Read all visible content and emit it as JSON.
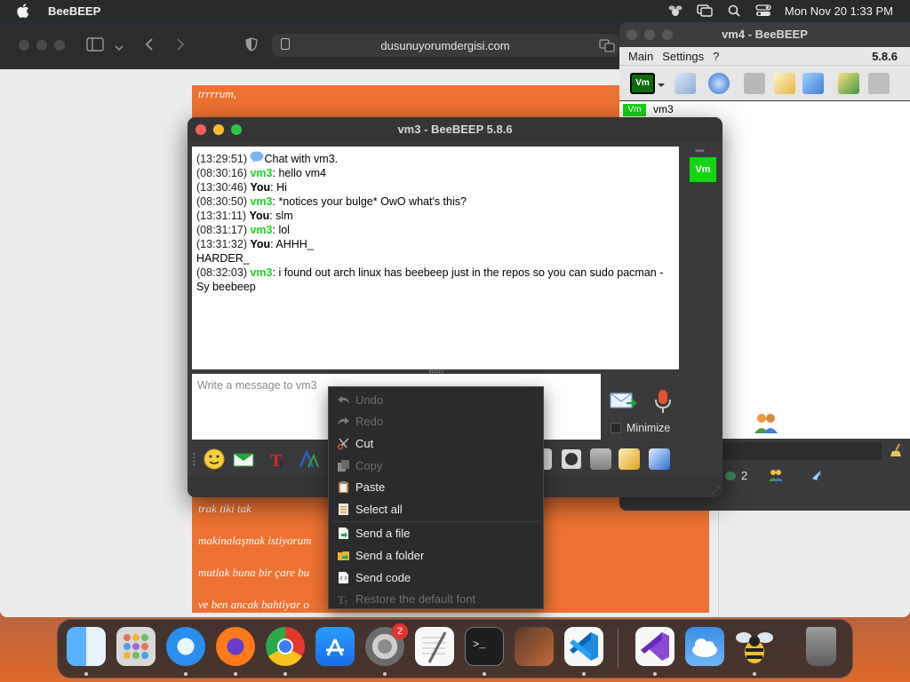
{
  "menubar": {
    "app_name": "BeeBEEP",
    "clock": "Mon Nov 20  1:33 PM"
  },
  "safari": {
    "url": "dusunuyorumdergisi.com",
    "article_lines": [
      "trrrrum,",
      "trak tiki tak",
      "makinalaşmak istiyorum",
      "mutlak buna bir çare bu",
      "ve ben ancak bahtiyar o"
    ],
    "colors": {
      "article_bg": "#ee7332"
    }
  },
  "vm4": {
    "title": "vm4 - BeeBEEP",
    "menu": [
      "Main",
      "Settings",
      "?"
    ],
    "version": "5.8.6",
    "avatar_label": "Vm",
    "user_name": "vm3",
    "status_count": "2"
  },
  "vm3": {
    "title": "vm3 - BeeBEEP 5.8.6",
    "badge": "Vm",
    "composer_placeholder": "Write a message to vm3",
    "minimize_label": "Minimize",
    "messages": [
      {
        "time": "(13:29:51)",
        "speaker": "",
        "text": "Chat with vm3.",
        "kind": "system"
      },
      {
        "time": "(08:30:16)",
        "speaker": "vm3",
        "text": ": hello vm4",
        "kind": "vm"
      },
      {
        "time": "(13:30:46)",
        "speaker": "You",
        "text": ": Hi",
        "kind": "you"
      },
      {
        "time": "(08:30:50)",
        "speaker": "vm3",
        "text": ": *notices your bulge* OwO what's this?",
        "kind": "vm"
      },
      {
        "time": "(13:31:11)",
        "speaker": "You",
        "text": ": slm",
        "kind": "you"
      },
      {
        "time": "(08:31:17)",
        "speaker": "vm3",
        "text": ": lol",
        "kind": "vm"
      },
      {
        "time": "(13:31:32)",
        "speaker": "You",
        "text": ": AHHH_\nHARDER_",
        "kind": "you"
      },
      {
        "time": "(08:32:03)",
        "speaker": "vm3",
        "text": ": i found out arch linux has beebeep just in the repos so you can sudo pacman -Sy beebeep",
        "kind": "vm"
      }
    ],
    "colors": {
      "vm_name": "#1fd12a"
    }
  },
  "context_menu": [
    {
      "label": "Undo",
      "icon": "undo-icon",
      "disabled": true
    },
    {
      "label": "Redo",
      "icon": "redo-icon",
      "disabled": true
    },
    {
      "label": "Cut",
      "icon": "scissors-icon",
      "disabled": false
    },
    {
      "label": "Copy",
      "icon": "copy-icon",
      "disabled": true
    },
    {
      "label": "Paste",
      "icon": "clipboard-icon",
      "disabled": false
    },
    {
      "label": "Select all",
      "icon": "select-all-icon",
      "disabled": false
    },
    {
      "label": "Send a file",
      "icon": "file-icon",
      "disabled": false
    },
    {
      "label": "Send a folder",
      "icon": "folder-icon",
      "disabled": false
    },
    {
      "label": "Send code",
      "icon": "code-icon",
      "disabled": false
    },
    {
      "label": "Restore the default font",
      "icon": "font-icon",
      "disabled": true
    }
  ],
  "dock": {
    "badge": "2",
    "apps": [
      "finder-icon",
      "launchpad-icon",
      "safari-icon",
      "firefox-icon",
      "chrome-icon",
      "app-store-icon",
      "system-settings-icon",
      "textedit-icon",
      "terminal-icon",
      "garageband-icon",
      "vscode-icon",
      "visual-studio-icon",
      "weather-icon",
      "beebeep-icon",
      "trash-icon"
    ]
  }
}
